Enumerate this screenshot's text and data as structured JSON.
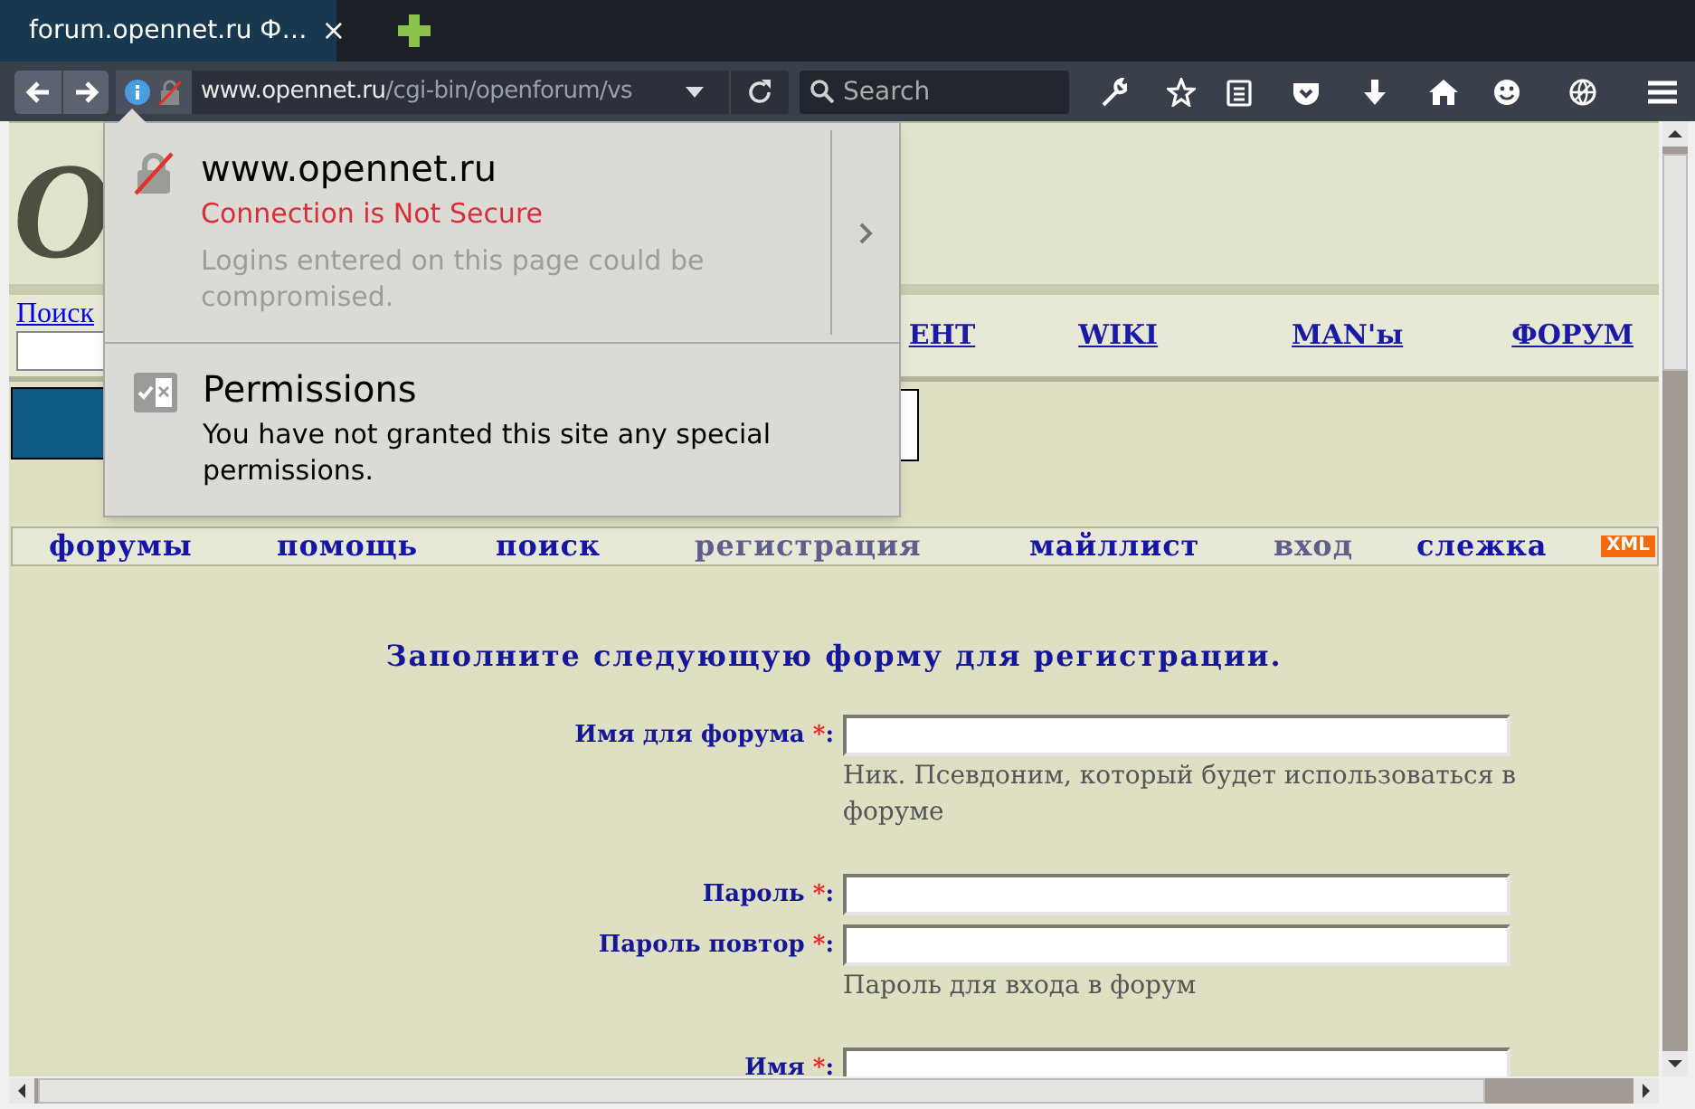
{
  "browser": {
    "tab": {
      "title": "forum.opennet.ru Ф…",
      "close": "×",
      "selected": true
    },
    "url": {
      "host": "www.opennet.ru",
      "path": "/cgi-bin/openforum/vs"
    },
    "search": {
      "placeholder": "Search"
    }
  },
  "site_info_popup": {
    "host": "www.opennet.ru",
    "status": "Connection is Not Secure",
    "warning": "Logins entered on this page could be compromised.",
    "permissions_title": "Permissions",
    "permissions_text": "You have not granted this site any special permissions."
  },
  "page": {
    "logo": "O",
    "search_link": "Поиск",
    "top_nav": [
      "ЕНТ",
      "WIKI",
      "MAN'ы",
      "ФОРУМ"
    ],
    "menu": [
      {
        "label": "форумы",
        "disabled": false
      },
      {
        "label": "помощь",
        "disabled": false
      },
      {
        "label": "поиск",
        "disabled": false
      },
      {
        "label": "регистрация",
        "disabled": true
      },
      {
        "label": "майллист",
        "disabled": false
      },
      {
        "label": "вход",
        "disabled": true
      },
      {
        "label": "слежка",
        "disabled": false
      }
    ],
    "xml_badge": "XML",
    "form": {
      "title": "Заполните следующую форму для регистрации.",
      "fields": [
        {
          "label": "Имя для форума",
          "required_mark": "*",
          "suffix": ":",
          "hint": "Ник. Псевдоним, который будет использоваться в форуме"
        },
        {
          "label": "Пароль",
          "required_mark": "*",
          "suffix": ":"
        },
        {
          "label": "Пароль повтор",
          "required_mark": "*",
          "suffix": ":",
          "hint": "Пароль для входа в форум"
        },
        {
          "label": "Имя",
          "required_mark": "*",
          "suffix": ":"
        }
      ]
    }
  }
}
